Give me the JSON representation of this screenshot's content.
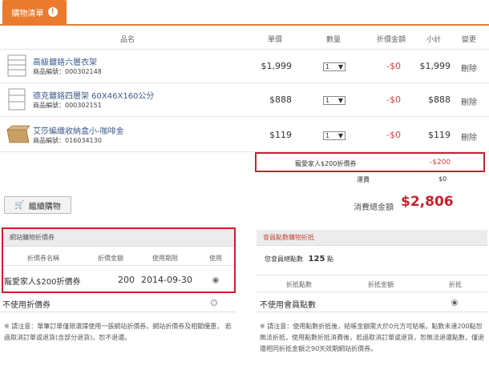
{
  "tab": {
    "label": "購物清單",
    "badge": "!"
  },
  "table_header": {
    "name": "品名",
    "unit_price": "單價",
    "quantity": "數量",
    "discount": "折價金額",
    "subtotal": "小計",
    "change": "變更"
  },
  "items": [
    {
      "name": "高級鍍鉻六層衣架",
      "code": "商品編號：000302148",
      "price": "$1,999",
      "qty": "1",
      "discount": "-$0",
      "subtotal": "$1,999",
      "action": "刪除",
      "icon": "shelf-rack"
    },
    {
      "name": "德克鍍鉻四層架 60X46X160公分",
      "code": "商品編號：000302151",
      "price": "$888",
      "qty": "1",
      "discount": "-$0",
      "subtotal": "$888",
      "action": "刪除",
      "icon": "shelf-rack"
    },
    {
      "name": "艾莎編織收納盒小-咖啡金",
      "code": "商品編號：016034130",
      "price": "$119",
      "qty": "1",
      "discount": "-$0",
      "subtotal": "$119",
      "action": "刪除",
      "icon": "wicker-box"
    }
  ],
  "coupon_applied": {
    "label": "寵愛家人$200折價券",
    "amount": "-$200"
  },
  "shipping": {
    "label": "運費",
    "amount": "$0"
  },
  "continue_button": "繼續購物",
  "total": {
    "label": "消費總金額",
    "amount": "$2,806"
  },
  "coupon_panel": {
    "title": "網站購物折價券",
    "headers": {
      "name": "折價券名稱",
      "amount": "折價金額",
      "expiry": "使用期限",
      "use": "使用"
    },
    "coupon": {
      "name": "寵愛家人$200折價券",
      "amount": "200",
      "expiry": "2014-09-30",
      "selected": true
    },
    "no_coupon": "不使用折價券",
    "note": "※ 請注意：單筆訂單僅限選擇使用一張網站折價券。網站折價券及相關優惠，  若過取消訂單或退貨(含部分退貨)，恕不退還。"
  },
  "points_panel": {
    "title": "會員點數購物折抵",
    "points_label": "您會員總點數",
    "points_value": "125",
    "points_unit": "點",
    "headers": {
      "points": "折抵點數",
      "amount": "折抵金額",
      "redeem": "折抵"
    },
    "no_points": "不使用會員點數",
    "note": "※ 請注意：使用點數折抵後，結帳金額需大於0元方可結帳。點數未達200點恕無法折抵，使用點數折抵消費後，若過取消訂單或退貨，恕無法退還點數，僅退還相同折抵金額之90天效期網站折價券。"
  },
  "colors": {
    "accent": "#ea7a2e",
    "highlight_box": "#c8202e",
    "total_red": "#c8202e",
    "link": "#3a5a8c"
  }
}
